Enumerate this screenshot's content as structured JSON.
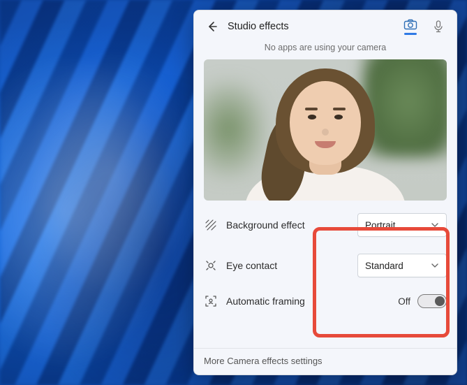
{
  "header": {
    "title": "Studio effects"
  },
  "status": "No apps are using your camera",
  "settings": {
    "background_effect": {
      "label": "Background effect",
      "value": "Portrait"
    },
    "eye_contact": {
      "label": "Eye contact",
      "value": "Standard"
    },
    "auto_framing": {
      "label": "Automatic framing",
      "state": "Off"
    }
  },
  "footer": {
    "link": "More Camera effects settings"
  }
}
